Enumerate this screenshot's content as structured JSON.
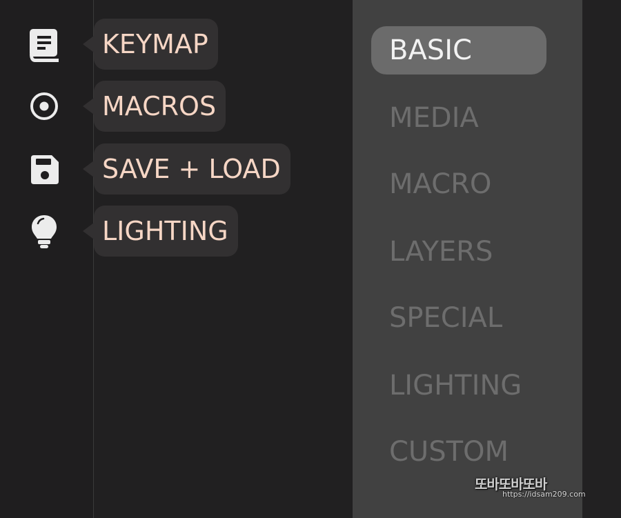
{
  "sidebar": {
    "items": [
      {
        "icon": "book-icon",
        "label": "KEYMAP"
      },
      {
        "icon": "record-icon",
        "label": "MACROS"
      },
      {
        "icon": "floppy-disk-icon",
        "label": "SAVE + LOAD"
      },
      {
        "icon": "lightbulb-icon",
        "label": "LIGHTING"
      }
    ]
  },
  "categories": {
    "active": "BASIC",
    "items": [
      "BASIC",
      "MEDIA",
      "MACRO",
      "LAYERS",
      "SPECIAL",
      "LIGHTING",
      "CUSTOM"
    ]
  },
  "watermark": {
    "logo": "또바또바또바",
    "url": "https://idsam209.com"
  },
  "colors": {
    "tooltip_text": "#f6d6c5",
    "tooltip_bg": "#323031",
    "panel_bg": "#414141",
    "active_item_bg": "#6b6b6b",
    "inactive_item_text": "#6d6d6d"
  }
}
